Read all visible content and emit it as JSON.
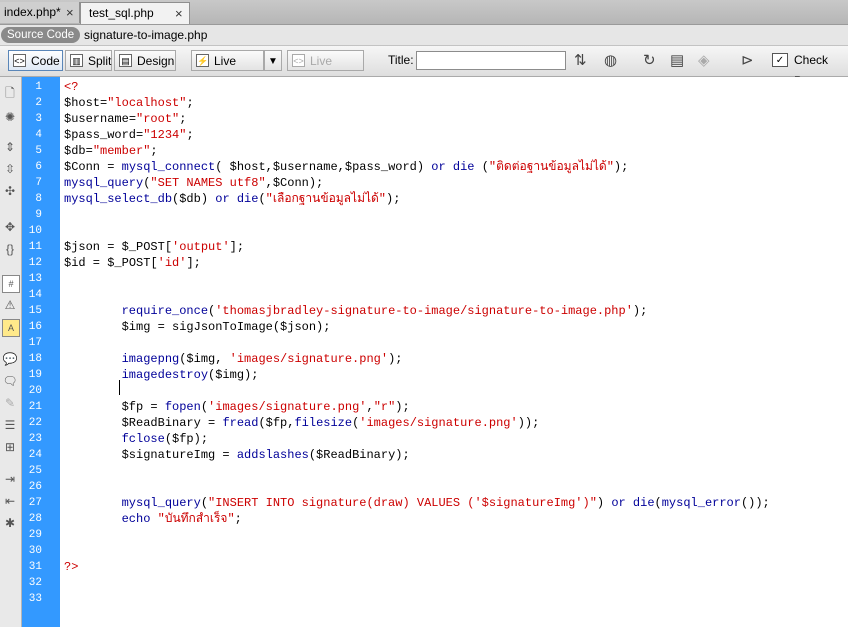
{
  "tabs": [
    {
      "label": "index.php*",
      "close": "×"
    },
    {
      "label": "test_sql.php",
      "close": "×"
    }
  ],
  "related": {
    "source_code": "Source Code",
    "file": "signature-to-image.php"
  },
  "toolbar": {
    "code": "Code",
    "split": "Split",
    "design": "Design",
    "live_view": "Live View",
    "live_code": "Live Code",
    "title_label": "Title:",
    "title_value": "",
    "check_page": "Check Page"
  },
  "line_numbers": [
    "1",
    "2",
    "3",
    "4",
    "5",
    "6",
    "7",
    "8",
    "9",
    "10",
    "11",
    "12",
    "13",
    "14",
    "15",
    "16",
    "17",
    "18",
    "19",
    "20",
    "21",
    "22",
    "23",
    "24",
    "25",
    "26",
    "27",
    "28",
    "29",
    "30",
    "31",
    "32",
    "33"
  ],
  "code_lines": [
    [
      [
        "k-tag",
        "<?"
      ]
    ],
    [
      [
        "k-var",
        "$host"
      ],
      [
        "",
        "="
      ],
      [
        "k-str",
        "\"localhost\""
      ],
      [
        "",
        ";"
      ]
    ],
    [
      [
        "k-var",
        "$username"
      ],
      [
        "",
        "="
      ],
      [
        "k-str",
        "\"root\""
      ],
      [
        "",
        ";"
      ]
    ],
    [
      [
        "k-var",
        "$pass_word"
      ],
      [
        "",
        "="
      ],
      [
        "k-str",
        "\"1234\""
      ],
      [
        "",
        ";"
      ]
    ],
    [
      [
        "k-var",
        "$db"
      ],
      [
        "",
        "="
      ],
      [
        "k-str",
        "\"member\""
      ],
      [
        "",
        ";"
      ]
    ],
    [
      [
        "k-var",
        "$Conn"
      ],
      [
        "",
        " = "
      ],
      [
        "k-fn",
        "mysql_connect"
      ],
      [
        "",
        "( $host,$username,$pass_word) "
      ],
      [
        "k-fn",
        "or die"
      ],
      [
        "",
        " ("
      ],
      [
        "k-str",
        "\"ติดต่อฐานข้อมูลไม่ได้\""
      ],
      [
        "",
        ");"
      ]
    ],
    [
      [
        "k-fn",
        "mysql_query"
      ],
      [
        "",
        "("
      ],
      [
        "k-str",
        "\"SET NAMES utf8\""
      ],
      [
        "",
        ",$Conn);"
      ]
    ],
    [
      [
        "k-fn",
        "mysql_select_db"
      ],
      [
        "",
        "($db) "
      ],
      [
        "k-fn",
        "or die"
      ],
      [
        "",
        "("
      ],
      [
        "k-str",
        "\"เลือกฐานข้อมูลไม่ได้\""
      ],
      [
        "",
        ");"
      ]
    ],
    [],
    [],
    [
      [
        "k-var",
        "$json"
      ],
      [
        "",
        " = "
      ],
      [
        "k-var",
        "$_POST"
      ],
      [
        "",
        "["
      ],
      [
        "k-str",
        "'output'"
      ],
      [
        "",
        "];"
      ]
    ],
    [
      [
        "k-var",
        "$id"
      ],
      [
        "",
        " = "
      ],
      [
        "k-var",
        "$_POST"
      ],
      [
        "",
        "["
      ],
      [
        "k-str",
        "'id'"
      ],
      [
        "",
        "];"
      ]
    ],
    [],
    [],
    [
      [
        "",
        "        "
      ],
      [
        "k-fn",
        "require_once"
      ],
      [
        "",
        "("
      ],
      [
        "k-str",
        "'thomasjbradley-signature-to-image/signature-to-image.php'"
      ],
      [
        "",
        ");"
      ]
    ],
    [
      [
        "",
        "        "
      ],
      [
        "k-var",
        "$img"
      ],
      [
        "",
        " = sigJsonToImage($json);"
      ]
    ],
    [],
    [
      [
        "",
        "        "
      ],
      [
        "k-fn",
        "imagepng"
      ],
      [
        "",
        "($img, "
      ],
      [
        "k-str",
        "'images/signature.png'"
      ],
      [
        "",
        ");"
      ]
    ],
    [
      [
        "",
        "        "
      ],
      [
        "k-fn",
        "imagedestroy"
      ],
      [
        "",
        "($img);"
      ]
    ],
    [],
    [
      [
        "",
        "        "
      ],
      [
        "k-var",
        "$fp"
      ],
      [
        "",
        " = "
      ],
      [
        "k-fn",
        "fopen"
      ],
      [
        "",
        "("
      ],
      [
        "k-str",
        "'images/signature.png'"
      ],
      [
        "",
        ","
      ],
      [
        "k-str",
        "\"r\""
      ],
      [
        "",
        ");"
      ]
    ],
    [
      [
        "",
        "        "
      ],
      [
        "k-var",
        "$ReadBinary"
      ],
      [
        "",
        " = "
      ],
      [
        "k-fn",
        "fread"
      ],
      [
        "",
        "($fp,"
      ],
      [
        "k-fn",
        "filesize"
      ],
      [
        "",
        "("
      ],
      [
        "k-str",
        "'images/signature.png'"
      ],
      [
        "",
        "));"
      ]
    ],
    [
      [
        "",
        "        "
      ],
      [
        "k-fn",
        "fclose"
      ],
      [
        "",
        "($fp);"
      ]
    ],
    [
      [
        "",
        "        "
      ],
      [
        "k-var",
        "$signatureImg"
      ],
      [
        "",
        " = "
      ],
      [
        "k-fn",
        "addslashes"
      ],
      [
        "",
        "($ReadBinary);"
      ]
    ],
    [],
    [],
    [
      [
        "",
        "        "
      ],
      [
        "k-fn",
        "mysql_query"
      ],
      [
        "",
        "("
      ],
      [
        "k-str",
        "\"INSERT INTO signature(draw) VALUES ('$signatureImg')\""
      ],
      [
        "",
        ") "
      ],
      [
        "k-fn",
        "or die"
      ],
      [
        "",
        "("
      ],
      [
        "k-fn",
        "mysql_error"
      ],
      [
        "",
        "());"
      ]
    ],
    [
      [
        "",
        "        "
      ],
      [
        "k-fn",
        "echo"
      ],
      [
        "",
        " "
      ],
      [
        "k-str",
        "\"บันทึกสำเร็จ\""
      ],
      [
        "",
        ";"
      ]
    ],
    [],
    [],
    [
      [
        "k-tag",
        "?>"
      ]
    ],
    [],
    []
  ]
}
